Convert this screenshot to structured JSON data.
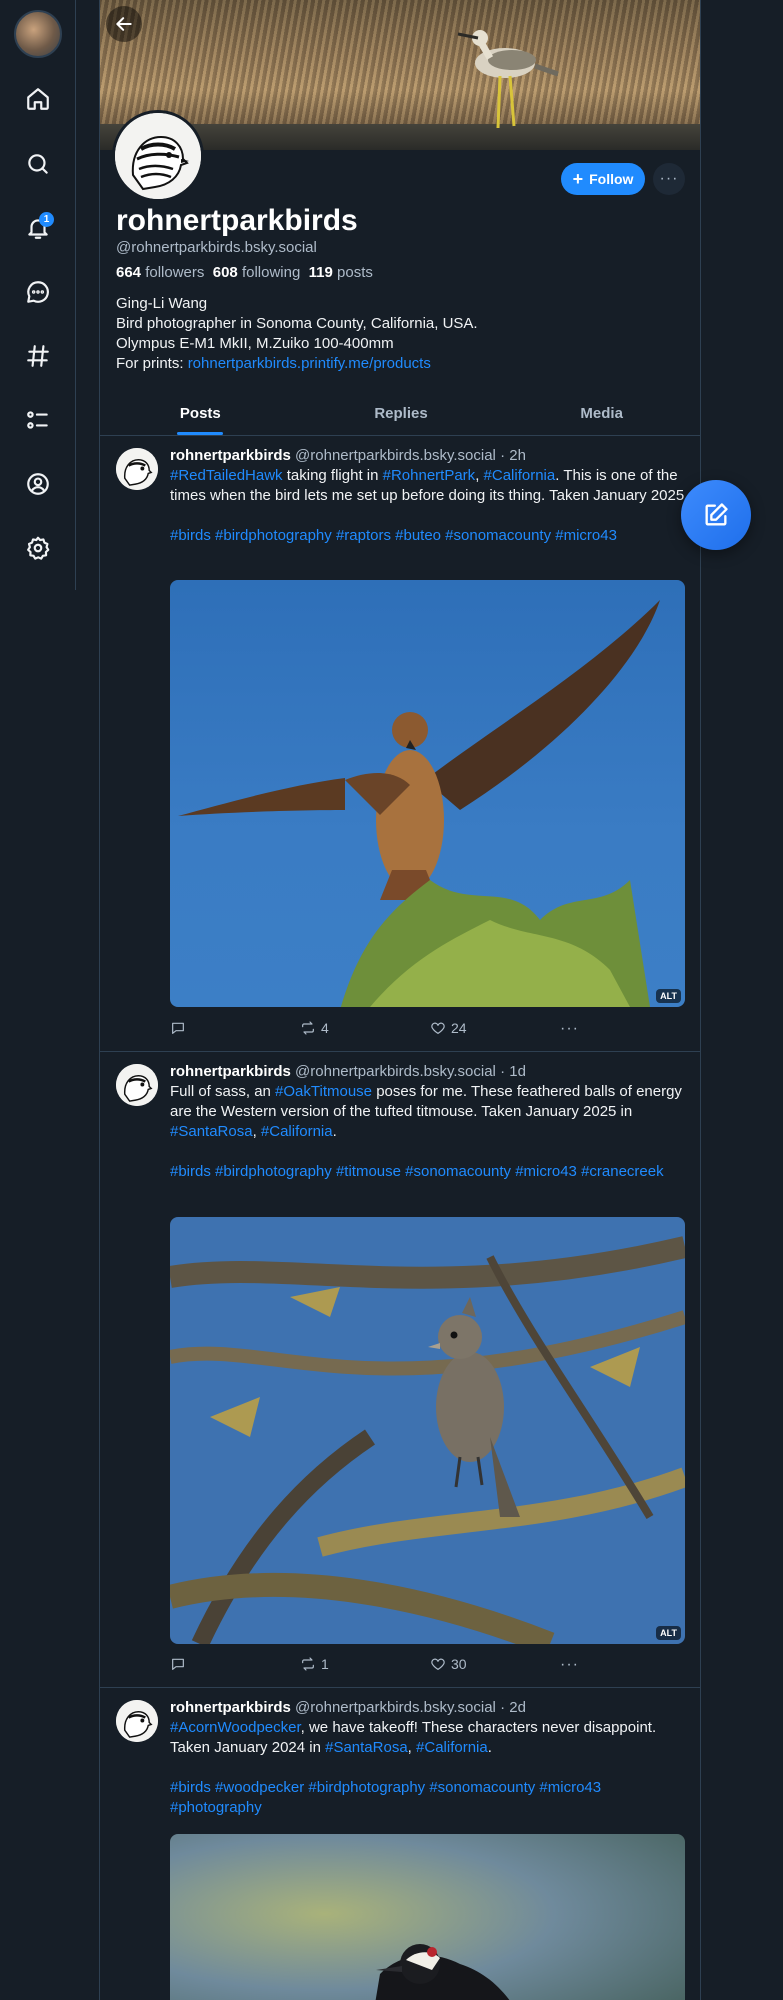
{
  "rail": {
    "notification_count": "1"
  },
  "profile": {
    "display_name": "rohnertparkbirds",
    "handle": "@rohnertparkbirds.bsky.social",
    "followers_count": "664",
    "followers_label": "followers",
    "following_count": "608",
    "following_label": "following",
    "posts_count": "119",
    "posts_label": "posts",
    "follow_label": "Follow",
    "more_label": "···",
    "bio_line1": "Ging-Li Wang",
    "bio_line2": "Bird photographer in Sonoma County, California, USA.",
    "bio_line3": "Olympus E-M1 MkII, M.Zuiko 100-400mm",
    "bio_prints_label": "For prints: ",
    "bio_prints_link": "rohnertparkbirds.printify.me/products"
  },
  "tabs": [
    {
      "label": "Posts",
      "active": true
    },
    {
      "label": "Replies",
      "active": false
    },
    {
      "label": "Media",
      "active": false
    }
  ],
  "posts": [
    {
      "author": "rohnertparkbirds",
      "handle": "@rohnertparkbirds.bsky.social",
      "time": "· 2h",
      "t1": "#RedTailedHawk",
      "t2": " taking flight in ",
      "t3": "#RohnertPark",
      "t4": ", ",
      "t5": "#California",
      "t6": ". This is one of the times when the bird lets me set up before doing its thing. Taken January 2025.",
      "tags": "#birds #birdphotography #raptors #buteo #sonomacounty #micro43",
      "alt": "ALT",
      "reposts": "4",
      "likes": "24"
    },
    {
      "author": "rohnertparkbirds",
      "handle": "@rohnertparkbirds.bsky.social",
      "time": "· 1d",
      "t1": "Full of sass, an ",
      "t2": "#OakTitmouse",
      "t3": " poses for me. These feathered balls of energy are the Western version of the tufted titmouse. Taken January 2025 in ",
      "t4": "#SantaRosa",
      "t5": ", ",
      "t6": "#California",
      "t7": ".",
      "tags": "#birds #birdphotography #titmouse #sonomacounty #micro43 #cranecreek",
      "alt": "ALT",
      "reposts": "1",
      "likes": "30"
    },
    {
      "author": "rohnertparkbirds",
      "handle": "@rohnertparkbirds.bsky.social",
      "time": "· 2d",
      "t1": "#AcornWoodpecker",
      "t2": ", we have takeoff! These characters never disappoint. Taken January 2024 in ",
      "t3": "#SantaRosa",
      "t4": ", ",
      "t5": "#California",
      "t6": ".",
      "tags": "#birds #woodpecker #birdphotography #sonomacounty #micro43 #photography"
    }
  ]
}
